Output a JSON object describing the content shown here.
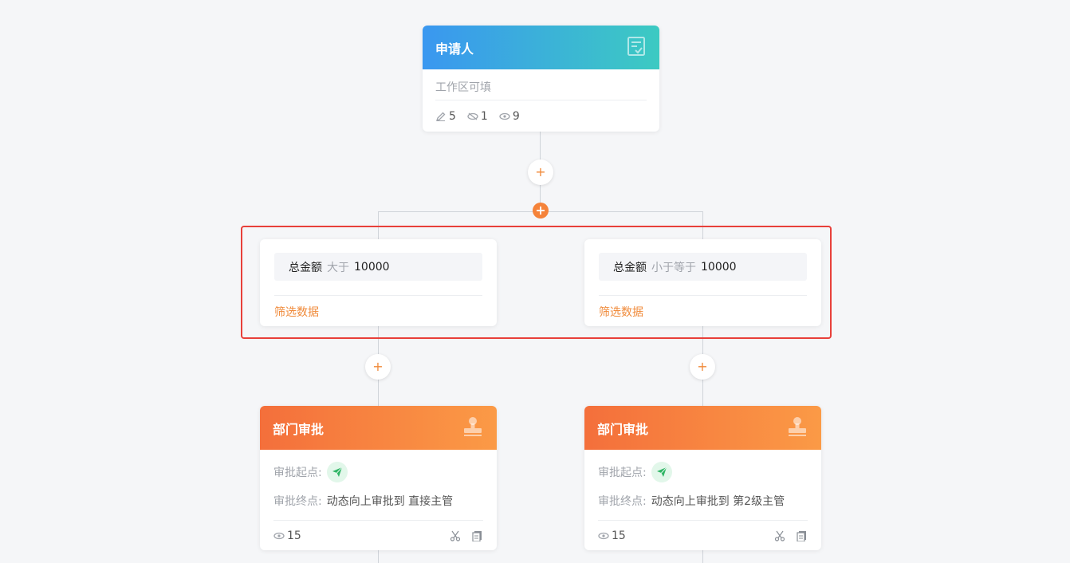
{
  "applicant": {
    "title": "申请人",
    "subtitle": "工作区可填",
    "stats": {
      "edit": "5",
      "hidden": "1",
      "visible": "9"
    }
  },
  "conditions": [
    {
      "field": "总金额",
      "op": "大于",
      "value": "10000",
      "link": "筛选数据"
    },
    {
      "field": "总金额",
      "op": "小于等于",
      "value": "10000",
      "link": "筛选数据"
    }
  ],
  "approvals": [
    {
      "title": "部门审批",
      "start_label": "审批起点:",
      "end_label": "审批终点:",
      "end_value": "动态向上审批到 直接主管",
      "views": "15"
    },
    {
      "title": "部门审批",
      "start_label": "审批起点:",
      "end_label": "审批终点:",
      "end_value": "动态向上审批到 第2级主管",
      "views": "15"
    }
  ],
  "add_symbol": "+",
  "colors": {
    "accent": "#f08a3a",
    "highlight": "#e8403a",
    "blue": "#3a97f0",
    "orange": "#f46f3b"
  }
}
